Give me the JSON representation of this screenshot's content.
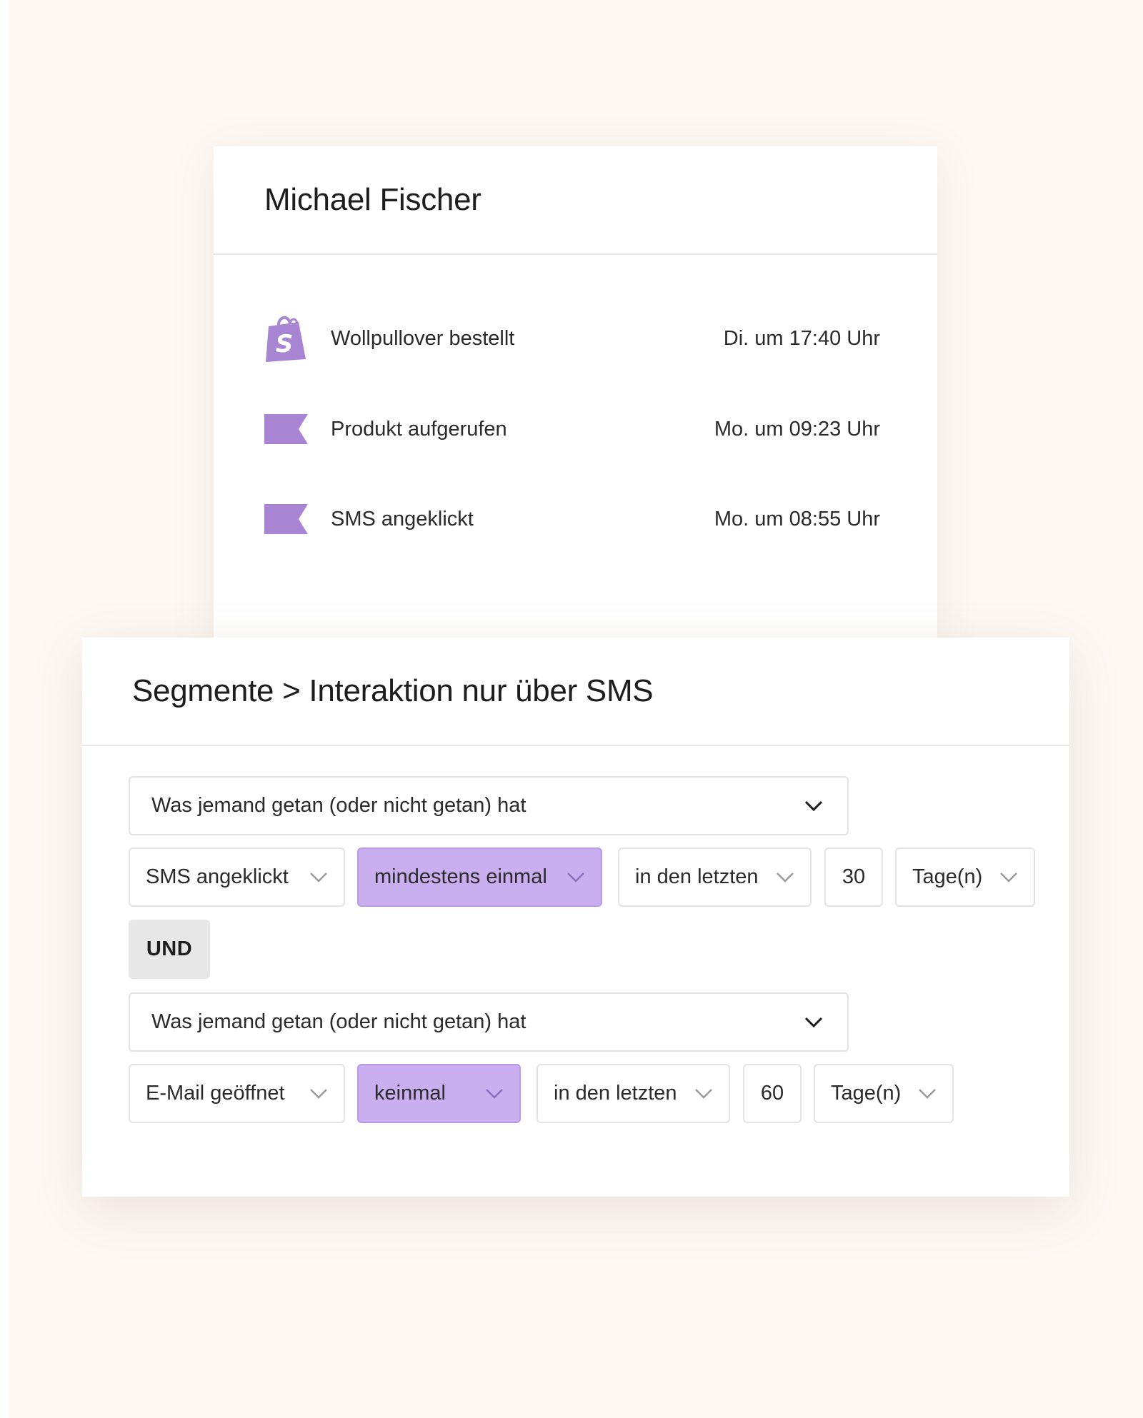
{
  "profile": {
    "name": "Michael Fischer",
    "events": [
      {
        "label": "Wollpullover bestellt",
        "time": "Di. um 17:40 Uhr",
        "icon": "shopify-bag-icon"
      },
      {
        "label": "Produkt aufgerufen",
        "time": "Mo. um 09:23 Uhr",
        "icon": "flag-icon"
      },
      {
        "label": "SMS angeklickt",
        "time": "Mo. um 08:55 Uhr",
        "icon": "flag-icon"
      }
    ]
  },
  "segment": {
    "breadcrumb": "Segmente > Interaktion nur über SMS",
    "conditions": [
      {
        "type": "Was jemand getan (oder nicht getan) hat",
        "event": "SMS angeklickt",
        "frequency": "mindestens einmal",
        "timeframe": "in den letzten",
        "amount": "30",
        "unit": "Tage(n)"
      },
      {
        "type": "Was jemand getan (oder nicht getan) hat",
        "event": "E-Mail geöffnet",
        "frequency": "keinmal",
        "timeframe": "in den letzten",
        "amount": "60",
        "unit": "Tage(n)"
      }
    ],
    "connector": "UND"
  },
  "colors": {
    "background": "#fdf8f3",
    "accent_purple": "#c9aef0",
    "icon_purple": "#a785d3",
    "und_gray": "#e7e7e7"
  }
}
